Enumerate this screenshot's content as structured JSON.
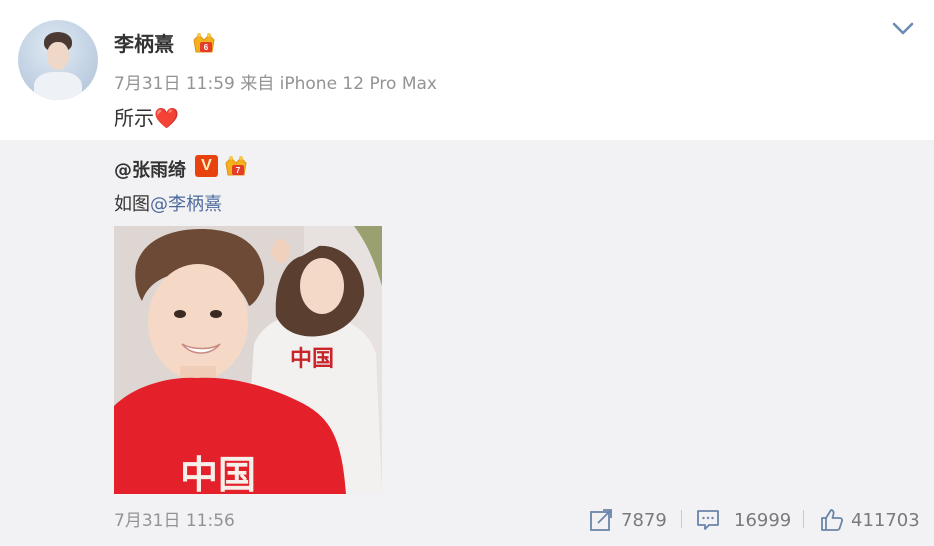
{
  "post": {
    "author": "李柄熹",
    "meta": "7月31日 11:59 来自 iPhone 12 Pro Max",
    "text": "所示",
    "emoji": "❤️"
  },
  "repost": {
    "author": "@张雨绮",
    "verified_mark": "V",
    "text_prefix": "如图",
    "mention": "@李柄熹",
    "timestamp": "7月31日 11:56",
    "shares": "7879",
    "comments": "16999",
    "likes": "411703"
  },
  "colors": {
    "mention": "#4c6a9a",
    "meta_gray": "#939393",
    "repost_bg": "#f2f2f5",
    "verified_orange": "#e8420f"
  },
  "icons": [
    "crown-badge-icon",
    "chevron-down-icon",
    "share-icon",
    "comment-icon",
    "like-icon"
  ]
}
